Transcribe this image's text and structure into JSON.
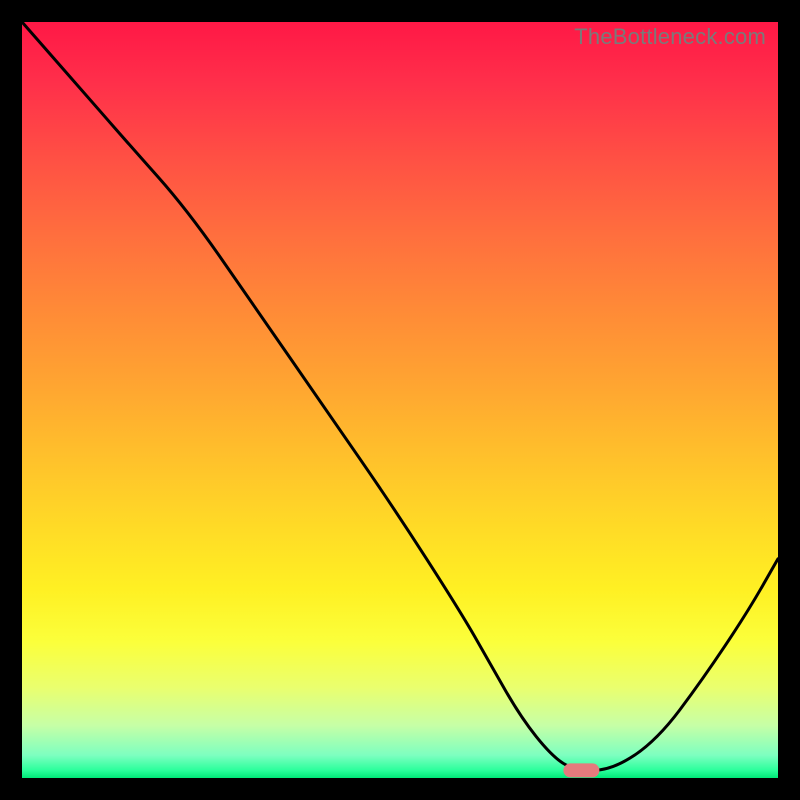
{
  "watermark": "TheBottleneck.com",
  "chart_data": {
    "type": "line",
    "title": "",
    "xlabel": "",
    "ylabel": "",
    "xlim": [
      0,
      100
    ],
    "ylim": [
      0,
      100
    ],
    "grid": false,
    "legend": false,
    "series": [
      {
        "name": "bottleneck-curve",
        "x": [
          0,
          7,
          14,
          22,
          31,
          40,
          49,
          58,
          62,
          66,
          70,
          73,
          78,
          84,
          90,
          96,
          100
        ],
        "y": [
          100,
          92,
          84,
          75,
          62,
          49,
          36,
          22,
          15,
          8,
          3,
          1,
          1,
          5,
          13,
          22,
          29
        ]
      }
    ],
    "marker": {
      "name": "optimal-point",
      "x": 74,
      "y": 1,
      "color": "#e57a7d",
      "shape": "capsule"
    },
    "background": {
      "type": "vertical-gradient",
      "stops": [
        {
          "pos": 0.0,
          "color": "#ff1846"
        },
        {
          "pos": 0.5,
          "color": "#ffb030"
        },
        {
          "pos": 0.8,
          "color": "#fcff30"
        },
        {
          "pos": 1.0,
          "color": "#00e878"
        }
      ]
    }
  }
}
